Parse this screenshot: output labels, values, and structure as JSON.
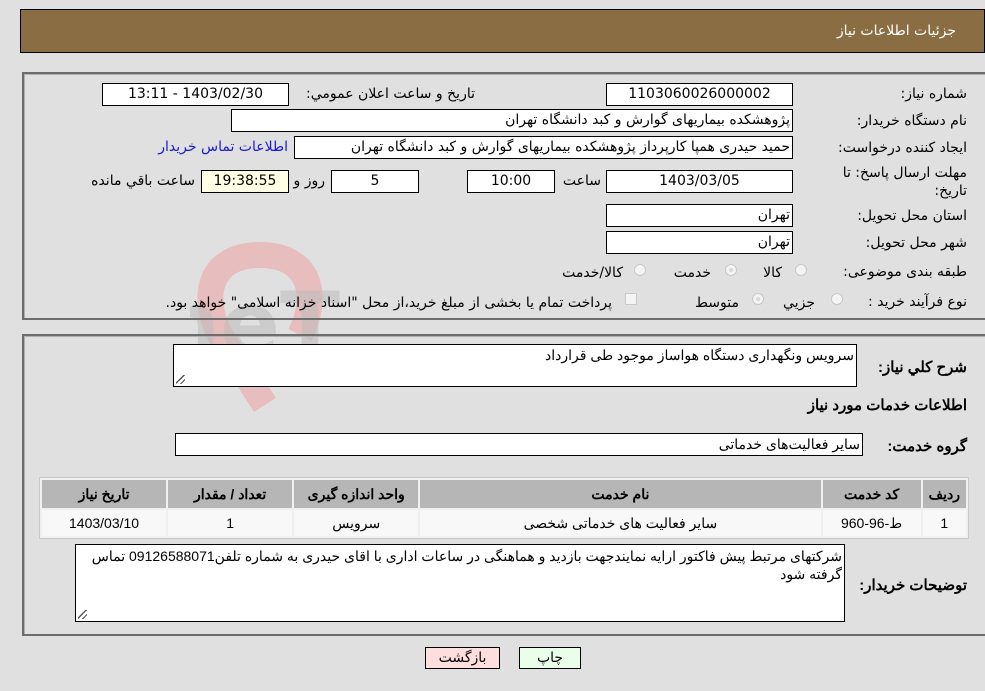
{
  "header": {
    "title": "جزئيات اطلاعات نياز"
  },
  "form": {
    "need_number_label": "شماره نياز:",
    "need_number": "1103060026000002",
    "announce_label": "تاريخ و ساعت اعلان عمومي:",
    "announce_value": "1403/02/30 - 13:11",
    "buyer_org_label": "نام دستگاه خريدار:",
    "buyer_org": "پژوهشکده بیماریهای گوارش و کبد دانشگاه تهران",
    "creator_label": "ايجاد کننده درخواست:",
    "creator": "حمید حیدری همپا کارپرداز پژوهشکده بیماریهای گوارش و کبد دانشگاه تهران",
    "contact_link": "اطلاعات تماس خريدار",
    "deadline_label": "مهلت ارسال پاسخ: تا تاريخ:",
    "deadline_date": "1403/03/05",
    "time_label": "ساعت",
    "deadline_time": "10:00",
    "days_value": "5",
    "days_label": "روز و",
    "remaining_time": "19:38:55",
    "remaining_label": "ساعت باقي مانده",
    "province_label": "استان محل تحويل:",
    "province": "تهران",
    "city_label": "شهر محل تحويل:",
    "city": "تهران",
    "category_label": "طبقه بندی موضوعی:",
    "category_options": [
      "کالا",
      "خدمت",
      "کالا/خدمت"
    ],
    "category_selected": "خدمت",
    "process_label": "نوع فرآيند خريد :",
    "process_options": [
      "جزيي",
      "متوسط"
    ],
    "process_selected": "متوسط",
    "treasury_note": "پرداخت تمام یا بخشی از مبلغ خرید،از محل \"اسناد خزانه اسلامی\" خواهد بود."
  },
  "details": {
    "summary_label": "شرح کلي نياز:",
    "summary": "سرویس ونگهداری دستگاه هواساز موجود طی قرارداد",
    "services_heading": "اطلاعات خدمات مورد نياز",
    "service_group_label": "گروه خدمت:",
    "service_group": "سایر فعالیت‌های خدماتی",
    "table": {
      "headers": [
        "رديف",
        "کد خدمت",
        "نام خدمت",
        "واحد اندازه گيری",
        "تعداد / مقدار",
        "تاريخ نياز"
      ],
      "rows": [
        [
          "1",
          "ط-96-960",
          "سایر فعالیت های خدماتی شخصی",
          "سرویس",
          "1",
          "1403/03/10"
        ]
      ]
    },
    "buyer_notes_label": "توضيحات خريدار:",
    "buyer_notes": "شرکتهای  مرتبط پیش فاکتور ارایه نمایندجهت بازدید و هماهنگی در ساعات اداری با اقای حیدری به شماره تلفن09126588071 تماس گرفته شود"
  },
  "buttons": {
    "print": "چاپ",
    "back": "بازگشت"
  },
  "watermark": {
    "text": "AriaTender.neT"
  },
  "colors": {
    "header": "#8b6d43",
    "link": "#1a1acc",
    "print_btn": "#eaffea",
    "back_btn": "#ffdede",
    "remaining_bg": "#ffffe6"
  }
}
